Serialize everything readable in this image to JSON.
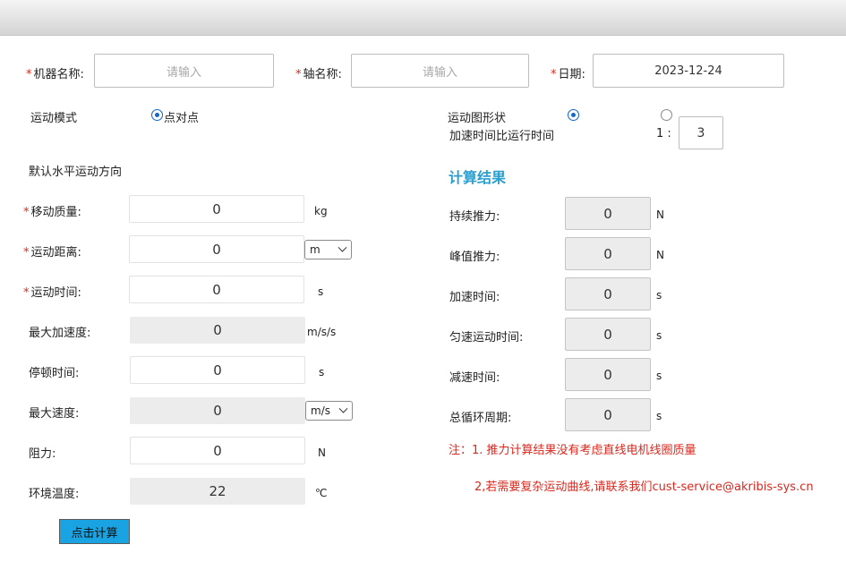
{
  "header": {
    "machine_name": {
      "label": "机器名称:",
      "placeholder": "请输入"
    },
    "axis_name": {
      "label": "轴名称:",
      "placeholder": "请输入"
    },
    "date": {
      "label": "日期:",
      "value": "2023-12-24"
    }
  },
  "motion_mode": {
    "label": "运动模式",
    "option_label": "点对点",
    "selected": true
  },
  "motion_shape": {
    "label": "运动图形状",
    "option1_selected": true,
    "option2_selected": false,
    "ratio_label": "加速时间比运行时间",
    "ratio_prefix": "1 :",
    "ratio_value": "3"
  },
  "default_direction": "默认水平运动方向",
  "inputs": {
    "mass": {
      "label": "移动质量:",
      "value": "0",
      "unit": "kg"
    },
    "distance": {
      "label": "运动距离:",
      "value": "0",
      "unit_select": "m"
    },
    "time": {
      "label": "运动时间:",
      "value": "0",
      "unit": "s"
    },
    "max_accel": {
      "label": "最大加速度:",
      "value": "0",
      "unit": "m/s/s"
    },
    "dwell": {
      "label": "停顿时间:",
      "value": "0",
      "unit": "s"
    },
    "max_speed": {
      "label": "最大速度:",
      "value": "0",
      "unit_select": "m/s"
    },
    "resistance": {
      "label": "阻力:",
      "value": "0",
      "unit": "N"
    },
    "temperature": {
      "label": "环境温度:",
      "value": "22",
      "unit": "℃"
    }
  },
  "results": {
    "title": "计算结果",
    "continuous_force": {
      "label": "持续推力:",
      "value": "0",
      "unit": "N"
    },
    "peak_force": {
      "label": "峰值推力:",
      "value": "0",
      "unit": "N"
    },
    "accel_time": {
      "label": "加速时间:",
      "value": "0",
      "unit": "s"
    },
    "constant_time": {
      "label": "匀速运动时间:",
      "value": "0",
      "unit": "s"
    },
    "decel_time": {
      "label": "减速时间:",
      "value": "0",
      "unit": "s"
    },
    "cycle_time": {
      "label": "总循环周期:",
      "value": "0",
      "unit": "s"
    }
  },
  "notes": {
    "note1": "注：1. 推力计算结果没有考虑直线电机线圈质量",
    "note2": "2,若需要复杂运动曲线,请联系我们cust-service@akribis-sys.cn"
  },
  "calc_button": "点击计算",
  "colors": {
    "accent": "#2a9fd0",
    "required": "#d9281e",
    "button": "#1aa3e3"
  }
}
